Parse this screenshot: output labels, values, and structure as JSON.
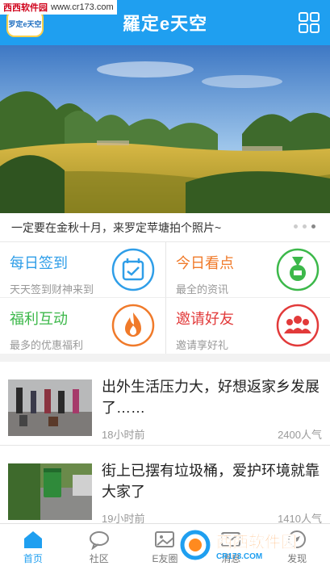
{
  "watermark": {
    "site_name": "西西软件园",
    "site_url": "www.cr173.com",
    "bottom_name": "西西软件园",
    "bottom_url": "CR173.COM"
  },
  "header": {
    "logo_text": "罗定e天空",
    "title": "羅定e天空",
    "menu_icon": "grid-icon"
  },
  "banner": {
    "caption": "一定要在金秋十月，来罗定苹塘拍个照片~",
    "dots": 3,
    "active_dot": 2
  },
  "features": [
    {
      "title": "每日签到",
      "subtitle": "天天签到财神来到",
      "color": "#2f9ee8",
      "icon": "calendar-check-icon"
    },
    {
      "title": "今日看点",
      "subtitle": "最全的资讯",
      "color": "#f07a2a",
      "icon": "medal-icon"
    },
    {
      "title": "福利互动",
      "subtitle": "最多的优惠福利",
      "color": "#3cb84a",
      "icon": "flame-icon"
    },
    {
      "title": "邀请好友",
      "subtitle": "邀请享好礼",
      "color": "#e23a3a",
      "icon": "group-icon"
    }
  ],
  "news": [
    {
      "title": "出外生活压力大，好想返家乡发展了……",
      "time": "18小时前",
      "views": "2400人气"
    },
    {
      "title": "街上已摆有垃圾桶，爱护环境就靠大家了",
      "time": "19小时前",
      "views": "1410人气"
    }
  ],
  "tabs": [
    {
      "label": "首页",
      "icon": "home-icon",
      "active": true
    },
    {
      "label": "社区",
      "icon": "chat-bubble-icon",
      "active": false
    },
    {
      "label": "E友圈",
      "icon": "image-icon",
      "active": false
    },
    {
      "label": "消息",
      "icon": "message-icon",
      "active": false
    },
    {
      "label": "发现",
      "icon": "compass-icon",
      "active": false
    }
  ],
  "colors": {
    "primary": "#1f9ff0"
  }
}
